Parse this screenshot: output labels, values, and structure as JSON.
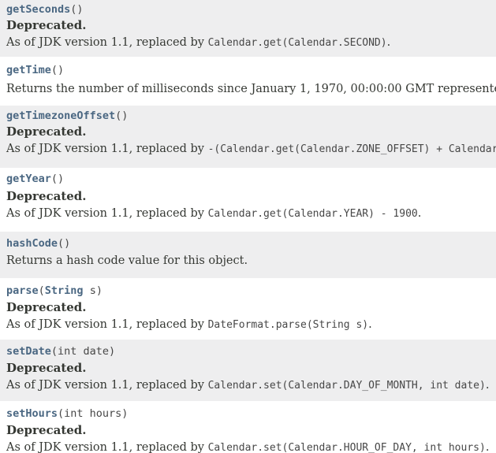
{
  "methods": [
    {
      "name": "getSeconds",
      "params_pre": "()",
      "deprecated": "Deprecated.",
      "desc_prefix": "As of JDK version 1.1, replaced by ",
      "desc_code": "Calendar.get(Calendar.SECOND)",
      "desc_suffix": "."
    },
    {
      "name": "getTime",
      "params_pre": "()",
      "desc_text": "Returns the number of milliseconds since January 1, 1970, 00:00:00 GMT represented by"
    },
    {
      "name": "getTimezoneOffset",
      "params_pre": "()",
      "deprecated": "Deprecated.",
      "desc_prefix": "As of JDK version 1.1, replaced by ",
      "desc_code": "-(Calendar.get(Calendar.ZONE_OFFSET) + Calendar.",
      "desc_suffix": ""
    },
    {
      "name": "getYear",
      "params_pre": "()",
      "deprecated": "Deprecated.",
      "desc_prefix": "As of JDK version 1.1, replaced by ",
      "desc_code": "Calendar.get(Calendar.YEAR) - 1900",
      "desc_suffix": "."
    },
    {
      "name": "hashCode",
      "params_pre": "()",
      "desc_text": "Returns a hash code value for this object."
    },
    {
      "name": "parse",
      "params_open": "(",
      "param_type": "String",
      "params_rest": " s)",
      "deprecated": "Deprecated.",
      "desc_prefix": "As of JDK version 1.1, replaced by ",
      "desc_code": "DateFormat.parse(String s)",
      "desc_suffix": "."
    },
    {
      "name": "setDate",
      "params_pre": "(int date)",
      "deprecated": "Deprecated.",
      "desc_prefix": "As of JDK version 1.1, replaced by ",
      "desc_code": "Calendar.set(Calendar.DAY_OF_MONTH, int date)",
      "desc_suffix": "."
    },
    {
      "name": "setHours",
      "params_pre": "(int hours)",
      "deprecated": "Deprecated.",
      "desc_prefix": "As of JDK version 1.1, replaced by ",
      "desc_code": "Calendar.set(Calendar.HOUR_OF_DAY, int hours)",
      "desc_suffix": "."
    }
  ],
  "colors": {
    "link": "#4a6782",
    "row_shade": "#eeeeef",
    "text": "#353833"
  }
}
